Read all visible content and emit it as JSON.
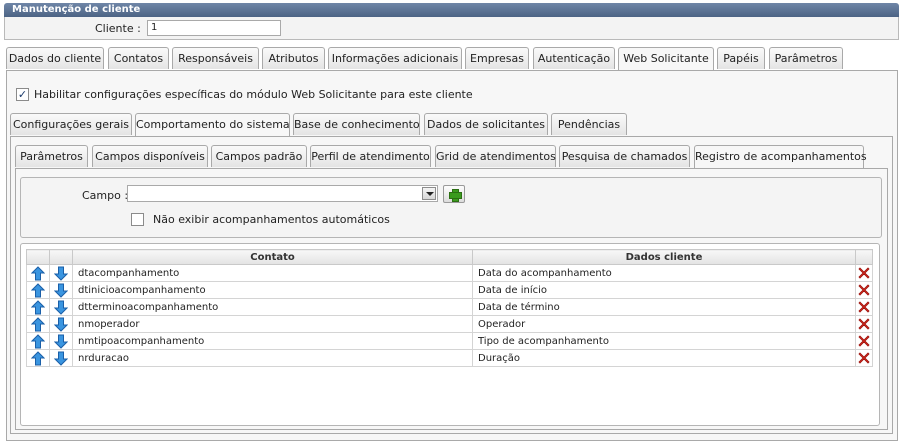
{
  "window": {
    "title": "Manutenção de cliente"
  },
  "client": {
    "label": "Cliente :",
    "value": "1"
  },
  "main_tabs": [
    {
      "label": "Dados do cliente"
    },
    {
      "label": "Contatos"
    },
    {
      "label": "Responsáveis"
    },
    {
      "label": "Atributos"
    },
    {
      "label": "Informações adicionais"
    },
    {
      "label": "Empresas"
    },
    {
      "label": "Autenticação"
    },
    {
      "label": "Web Solicitante"
    },
    {
      "label": "Papéis"
    },
    {
      "label": "Parâmetros"
    }
  ],
  "main_active_tab": "Web Solicitante",
  "enable_web": {
    "label": "Habilitar configurações específicas do módulo Web Solicitante para este cliente",
    "checked": true
  },
  "sub_tabs": [
    {
      "label": "Configurações gerais"
    },
    {
      "label": "Comportamento do sistema"
    },
    {
      "label": "Base de conhecimento"
    },
    {
      "label": "Dados de solicitantes"
    },
    {
      "label": "Pendências"
    }
  ],
  "sub_active_tab": "Comportamento do sistema",
  "inner_tabs": [
    {
      "label": "Parâmetros"
    },
    {
      "label": "Campos disponíveis"
    },
    {
      "label": "Campos padrão"
    },
    {
      "label": "Perfil de atendimento"
    },
    {
      "label": "Grid de atendimentos"
    },
    {
      "label": "Pesquisa de chamados"
    },
    {
      "label": "Registro de acompanhamentos"
    }
  ],
  "inner_active_tab": "Registro de acompanhamentos",
  "field": {
    "label": "Campo :",
    "value": ""
  },
  "hide_auto": {
    "label": "Não exibir acompanhamentos automáticos",
    "checked": false
  },
  "grid": {
    "headers": {
      "contato": "Contato",
      "dados_cliente": "Dados cliente"
    },
    "rows": [
      {
        "contato": "dtacompanhamento",
        "dados_cliente": "Data do acompanhamento"
      },
      {
        "contato": "dtinicioacompanhamento",
        "dados_cliente": "Data de início"
      },
      {
        "contato": "dtterminoacompanhamento",
        "dados_cliente": "Data de término"
      },
      {
        "contato": "nmoperador",
        "dados_cliente": "Operador"
      },
      {
        "contato": "nmtipoacompanhamento",
        "dados_cliente": "Tipo de acompanhamento"
      },
      {
        "contato": "nrduracao",
        "dados_cliente": "Duração"
      }
    ]
  },
  "icons": {
    "up": "arrow-up-icon",
    "down": "arrow-down-icon",
    "delete": "delete-x-icon",
    "add": "add-plus-icon"
  },
  "colors": {
    "title_bar": "#566e90",
    "arrow_blue": "#2f8ad8",
    "delete_red": "#d4231c",
    "add_green": "#3a9b1e"
  }
}
